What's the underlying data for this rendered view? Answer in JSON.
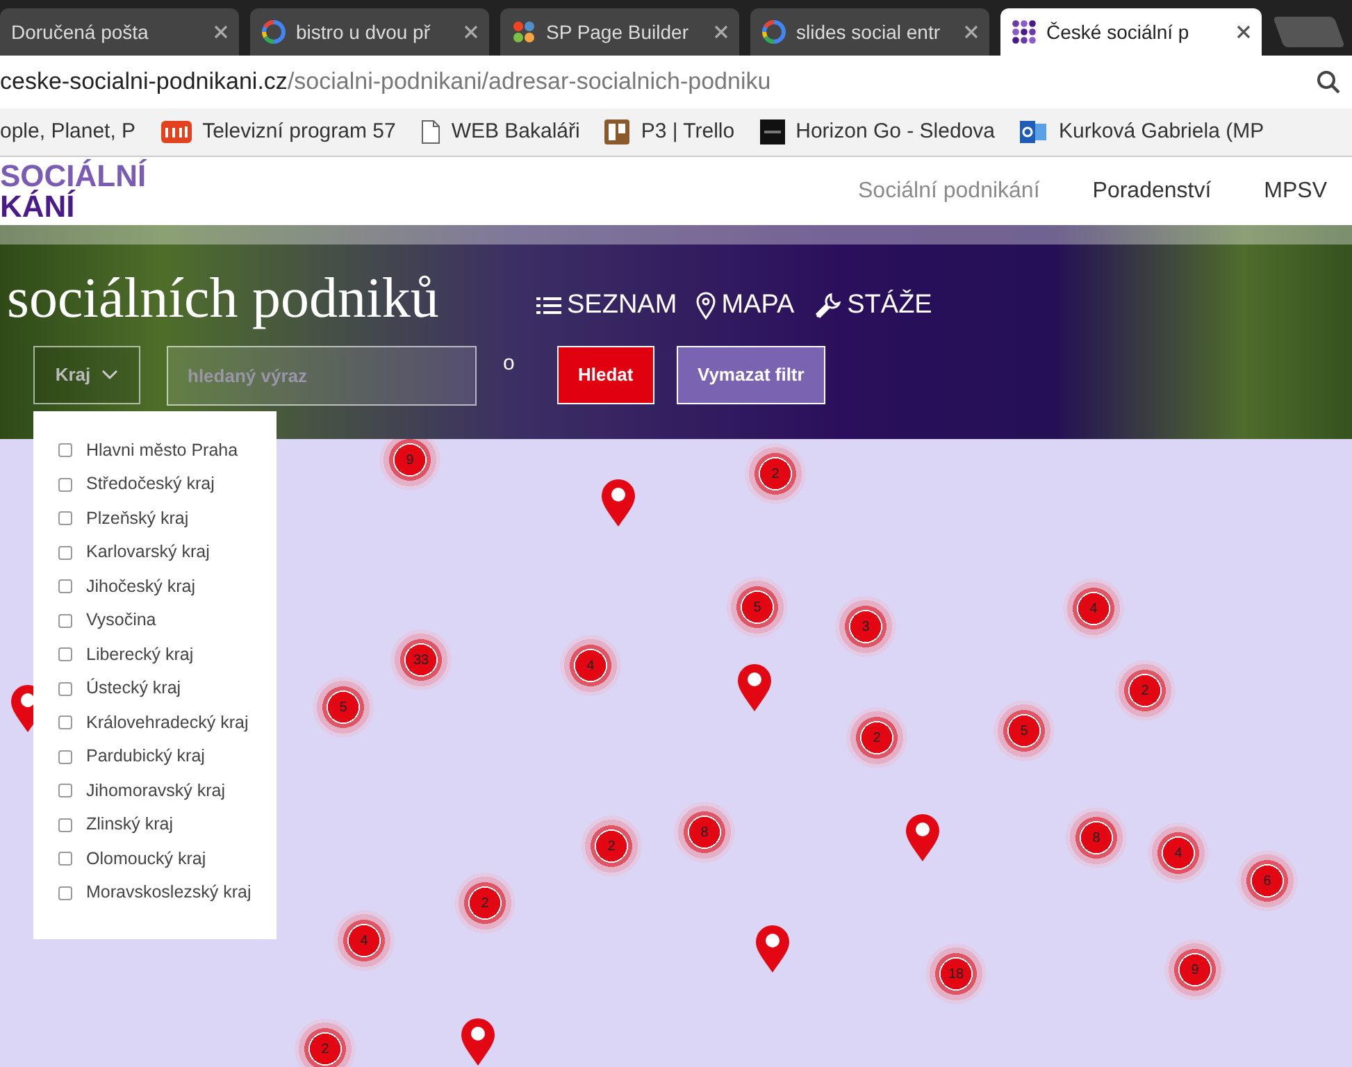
{
  "browser": {
    "tabs": [
      {
        "title": "Doručená pošta",
        "selected": false
      },
      {
        "title": "bistro u dvou př",
        "selected": false
      },
      {
        "title": "SP Page Builder",
        "selected": false
      },
      {
        "title": "slides social entr",
        "selected": false
      },
      {
        "title": "České sociální p",
        "selected": true
      }
    ],
    "url_host": "ceske-socialni-podnikani.cz",
    "url_path": "/socialni-podnikani/adresar-socialnich-podniku",
    "bookmarks": [
      {
        "title": "ople, Planet, P"
      },
      {
        "title": "Televizní program 57"
      },
      {
        "title": "WEB Bakaláři"
      },
      {
        "title": "P3 | Trello"
      },
      {
        "title": "Horizon Go - Sledova"
      },
      {
        "title": "Kurková Gabriela (MP"
      }
    ]
  },
  "site": {
    "logo_line_1": "SOCIÁLNÍ",
    "logo_line_2": "KÁNÍ",
    "nav": [
      {
        "label": "Sociální podnikání",
        "selected": true
      },
      {
        "label": "Poradenství",
        "selected": false
      },
      {
        "label": "MPSV",
        "selected": false
      }
    ]
  },
  "hero": {
    "title": "sociálních podniků",
    "views": [
      {
        "label": "SEZNAM"
      },
      {
        "label": "MAPA"
      },
      {
        "label": "STÁŽE"
      }
    ],
    "region_select": {
      "label": "Kraj",
      "expanded": true
    },
    "search": {
      "placeholder": "hledaný výraz"
    },
    "separator": "o",
    "buttons": [
      {
        "label": "Hledat",
        "kind": "primary"
      },
      {
        "label": "Vymazat filtr",
        "kind": "secondary"
      }
    ]
  },
  "region_options": [
    {
      "label": "Hlavni město Praha",
      "checked": false
    },
    {
      "label": "Středočeský kraj",
      "checked": false
    },
    {
      "label": "Plzeňský kraj",
      "checked": false
    },
    {
      "label": "Karlovarský kraj",
      "checked": false
    },
    {
      "label": "Jihočeský kraj",
      "checked": false
    },
    {
      "label": "Vysočina",
      "checked": false
    },
    {
      "label": "Liberecký kraj",
      "checked": false
    },
    {
      "label": "Ústecký kraj",
      "checked": false
    },
    {
      "label": "Královehradecký kraj",
      "checked": false
    },
    {
      "label": "Pardubický kraj",
      "checked": false
    },
    {
      "label": "Jihomoravský kraj",
      "checked": false
    },
    {
      "label": "Zlinský kraj",
      "checked": false
    },
    {
      "label": "Olomoucký kraj",
      "checked": false
    },
    {
      "label": "Moravskoslezský kraj",
      "checked": false
    }
  ],
  "map_markers": [
    {
      "kind": "cluster",
      "count": "9"
    },
    {
      "kind": "cluster",
      "count": "2"
    },
    {
      "kind": "cluster",
      "count": "5"
    },
    {
      "kind": "cluster",
      "count": "3"
    },
    {
      "kind": "cluster",
      "count": "4"
    },
    {
      "kind": "cluster",
      "count": "33"
    },
    {
      "kind": "cluster",
      "count": "4"
    },
    {
      "kind": "cluster",
      "count": "5"
    },
    {
      "kind": "cluster",
      "count": "2"
    },
    {
      "kind": "cluster",
      "count": "2"
    },
    {
      "kind": "cluster",
      "count": "5"
    },
    {
      "kind": "cluster",
      "count": "8"
    },
    {
      "kind": "cluster",
      "count": "4"
    },
    {
      "kind": "cluster",
      "count": "6"
    },
    {
      "kind": "cluster",
      "count": "2"
    },
    {
      "kind": "cluster",
      "count": "8"
    },
    {
      "kind": "cluster",
      "count": "2"
    },
    {
      "kind": "cluster",
      "count": "4"
    },
    {
      "kind": "cluster",
      "count": "18"
    },
    {
      "kind": "cluster",
      "count": "9"
    },
    {
      "kind": "cluster",
      "count": "2"
    },
    {
      "kind": "pin"
    },
    {
      "kind": "pin"
    },
    {
      "kind": "pin"
    },
    {
      "kind": "pin"
    },
    {
      "kind": "pin"
    },
    {
      "kind": "pin"
    }
  ]
}
